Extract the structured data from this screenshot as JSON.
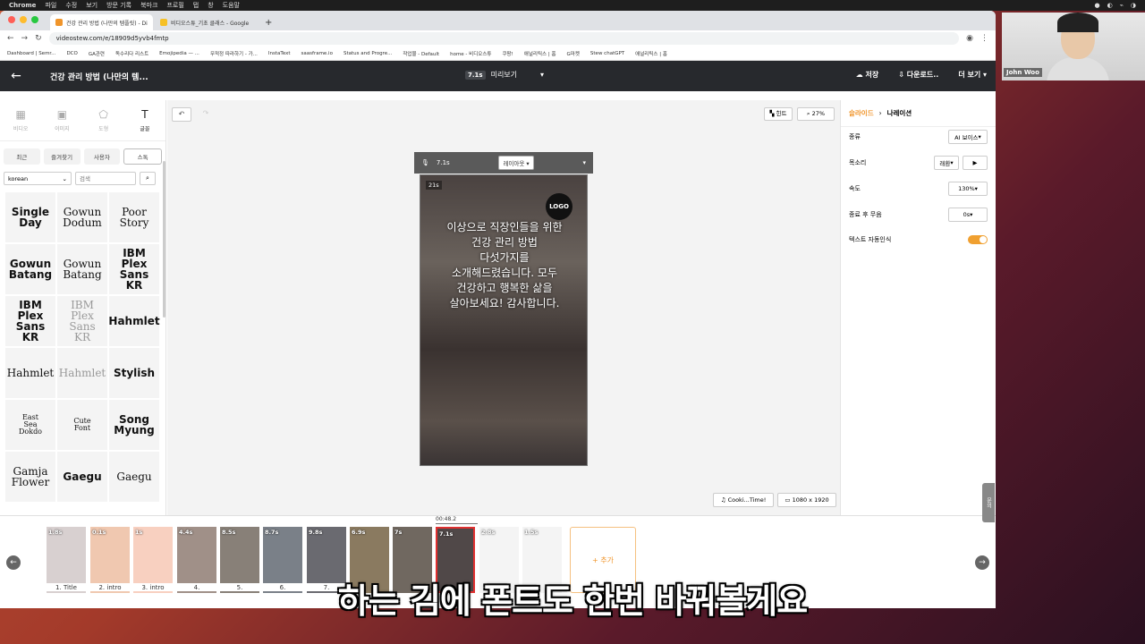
{
  "mac_menu": {
    "items": [
      "Chrome",
      "파일",
      "수정",
      "보기",
      "방문 기록",
      "북마크",
      "프로필",
      "탭",
      "창",
      "도움말"
    ]
  },
  "browser": {
    "tabs": [
      {
        "title": "건강 관리 방법 (나만의 템플릿) - Di",
        "color": "#f0952b"
      },
      {
        "title": "비디오스튜_기초 클래스 - Google",
        "color": "#f6c026"
      }
    ],
    "url": "videostew.com/e/18909d5yvb4fmtp",
    "bookmarks": [
      "Dashboard | Semr...",
      "DCO",
      "GA관련",
      "독수리다 리스트",
      "Emojipedia — ...",
      "무적정 따라하기 - 가...",
      "InstaText",
      "saasframe.io",
      "Status and Progre...",
      "작업물 - Default",
      "home - 비디오스튜",
      "쿠팡!",
      "애널리틱스 | 홈",
      "G마켓",
      "Stew chatGPT",
      "애널리틱스 | 홈"
    ]
  },
  "header": {
    "title": "건강 관리 방법 (나만의 템...",
    "preview_time": "7.1s",
    "preview_label": "미리보기",
    "save": "저장",
    "download": "다운로드..",
    "more": "더 보기"
  },
  "left_panel": {
    "tool_tabs": [
      {
        "label": "비디오",
        "icon": "▦"
      },
      {
        "label": "이미지",
        "icon": "▣"
      },
      {
        "label": "도형",
        "icon": "⬠"
      },
      {
        "label": "글꼴",
        "icon": "T"
      }
    ],
    "font_categories": [
      "최근",
      "즐겨찾기",
      "사용자",
      "스톡"
    ],
    "language": "korean",
    "search_placeholder": "검색",
    "fonts": [
      {
        "name": "Single\nDay"
      },
      {
        "name": "Gowun\nDodum"
      },
      {
        "name": "Poor\nStory"
      },
      {
        "name": "Gowun\nBatang"
      },
      {
        "name": "Gowun\nBatang"
      },
      {
        "name": "IBM\nPlex\nSans\nKR"
      },
      {
        "name": "IBM\nPlex\nSans\nKR"
      },
      {
        "name": "IBM\nPlex\nSans\nKR"
      },
      {
        "name": "Hahmlet"
      },
      {
        "name": "Hahmlet"
      },
      {
        "name": "Hahmlet"
      },
      {
        "name": "Stylish"
      },
      {
        "name": "East\nSea\nDokdo"
      },
      {
        "name": "Cute\nFont"
      },
      {
        "name": "Song\nMyung"
      },
      {
        "name": "Gamja\nFlower"
      },
      {
        "name": "Gaegu"
      },
      {
        "name": "Gaegu"
      }
    ]
  },
  "canvas": {
    "hint": "힌트",
    "zoom": "27%",
    "slide_time": "7.1s",
    "layout": "레이아웃",
    "duration_badge": "21s",
    "logo": "LOGO",
    "narration": "이상으로 직장인들을 위한\n건강 관리 방법\n다섯가지를\n소개해드렸습니다. 모두\n건강하고 행복한 삶을\n살아보세요! 감사합니다.",
    "audio": "Cooki...Time!",
    "resolution": "1080 x 1920"
  },
  "right_panel": {
    "breadcrumb": [
      "슬라이드",
      "나레이션"
    ],
    "props": [
      {
        "label": "종류",
        "value": "AI 보이스"
      },
      {
        "label": "목소리",
        "value": "래환"
      },
      {
        "label": "속도",
        "value": "130%"
      },
      {
        "label": "종료 후 무음",
        "value": "0s"
      },
      {
        "label": "텍스트 자동인식",
        "value": ""
      }
    ]
  },
  "timeline": {
    "timecode": "00:48.2",
    "add_label": "+ 추가",
    "slides": [
      {
        "dur": "1.8s",
        "label": "1. Title",
        "bg": "#d8d0d0"
      },
      {
        "dur": "0.1s",
        "label": "2. intro",
        "bg": "#f0c8b0"
      },
      {
        "dur": "1s",
        "label": "3. intro",
        "bg": "#f8d0c0"
      },
      {
        "dur": "4.4s",
        "label": "4.",
        "bg": "#a09088"
      },
      {
        "dur": "8.5s",
        "label": "5.",
        "bg": "#888078"
      },
      {
        "dur": "8.7s",
        "label": "6.",
        "bg": "#7a8088"
      },
      {
        "dur": "9.8s",
        "label": "7.",
        "bg": "#6a6a70"
      },
      {
        "dur": "6.9s",
        "label": "",
        "bg": "#8a7a60"
      },
      {
        "dur": "7s",
        "label": "",
        "bg": "#706860"
      },
      {
        "dur": "7.1s",
        "label": "",
        "bg": "#504848"
      },
      {
        "dur": "2.8s",
        "label": "",
        "bg": "#f4f4f4"
      },
      {
        "dur": "1.5s",
        "label": "",
        "bg": "#f4f4f4"
      }
    ]
  },
  "inquiry": "문의",
  "caption": "하는 김에 폰트도 한번 바꿔볼게요",
  "webcam_name": "John Woo"
}
